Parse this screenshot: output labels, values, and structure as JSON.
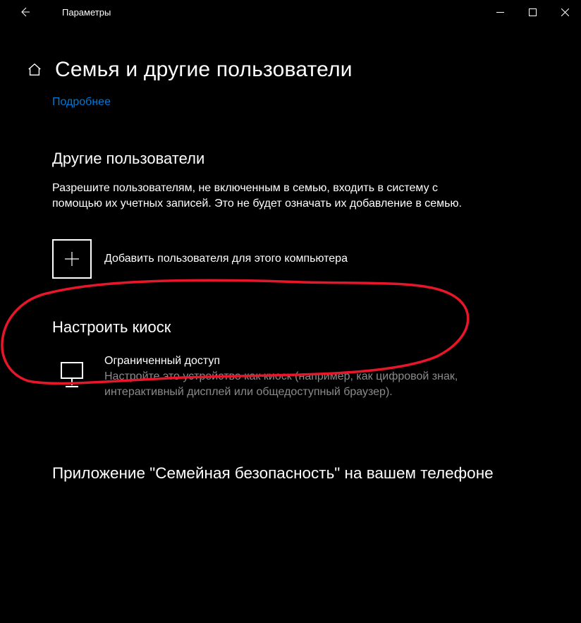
{
  "titlebar": {
    "app_title": "Параметры"
  },
  "header": {
    "title": "Семья и другие пользователи"
  },
  "link_more": "Подробнее",
  "other_users": {
    "heading": "Другие пользователи",
    "desc": "Разрешите пользователям, не включенным в семью, входить в систему с помощью их учетных записей. Это не будет означать их добавление в семью.",
    "add_label": "Добавить пользователя для этого компьютера"
  },
  "kiosk": {
    "heading": "Настроить киоск",
    "title": "Ограниченный доступ",
    "desc": "Настройте это устройство как киоск (например, как цифровой знак, интерактивный дисплей или общедоступный браузер)."
  },
  "safety_heading": "Приложение \"Семейная безопасность\" на вашем телефоне"
}
